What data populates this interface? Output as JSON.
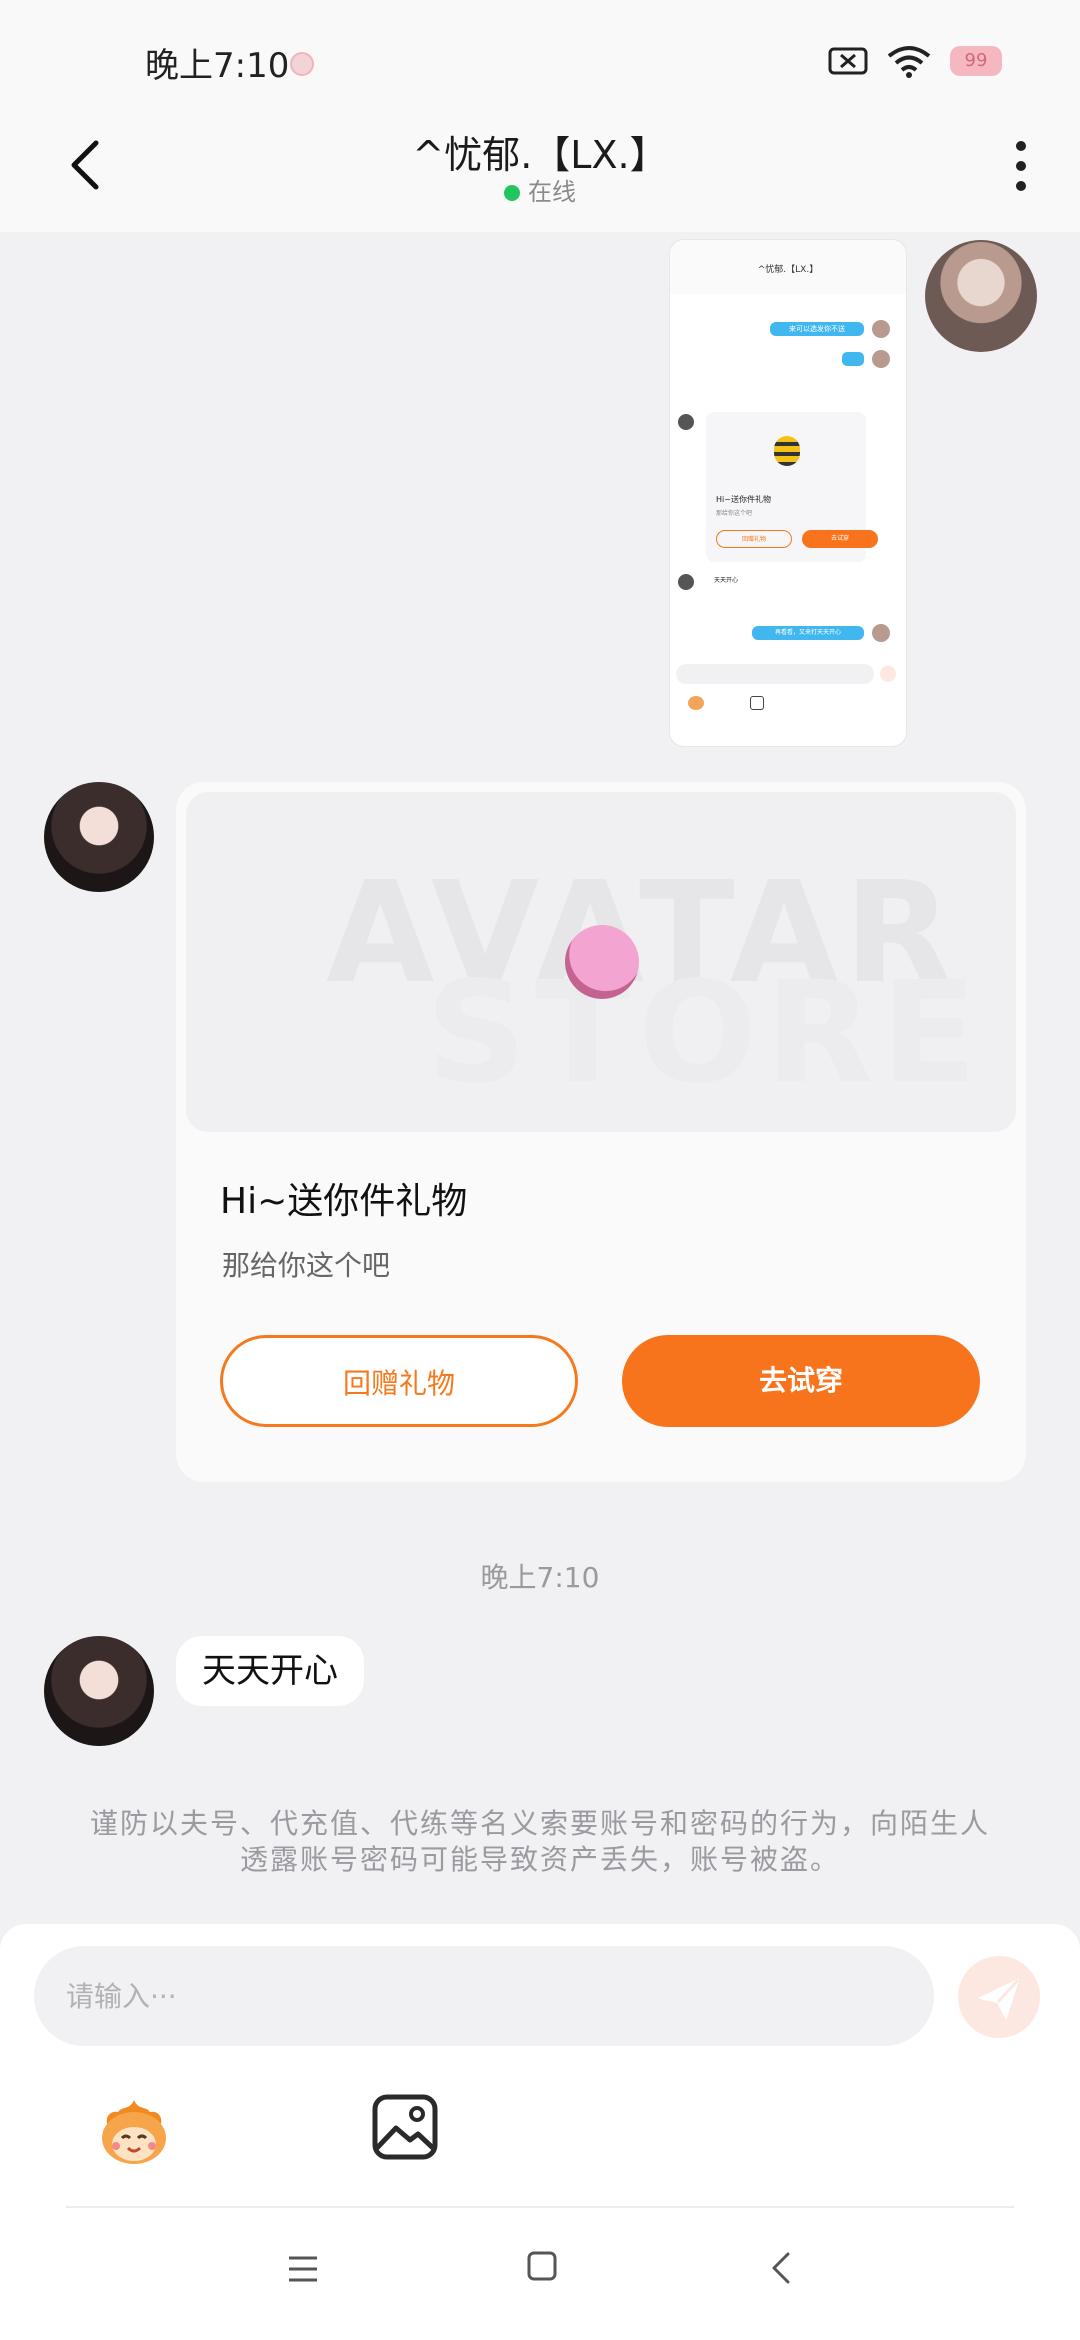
{
  "status_bar": {
    "time": "晚上7:10",
    "battery": "99"
  },
  "header": {
    "title": "^忧郁.【LX.】",
    "status": "在线"
  },
  "screenshot_thumbnail": {
    "title": "^忧郁.【LX.】",
    "bubble_1": "来可以选发你不送",
    "gift_title": "Hi~送你件礼物",
    "gift_sub": "那给你这个吧",
    "btn_return": "回赠礼物",
    "btn_try": "去试穿",
    "text_msg": "天天开心",
    "bubble_2": "再看看，又来打天天开心"
  },
  "gift_card": {
    "watermark_top": "AVATAR",
    "watermark_bottom": "STORE",
    "title": "Hi~送你件礼物",
    "subtitle": "那给你这个吧",
    "return_gift_label": "回赠礼物",
    "try_on_label": "去试穿"
  },
  "timestamp": "晚上7:10",
  "text_message": "天天开心",
  "warning": "谨防以夫号、代充值、代练等名义索要账号和密码的行为，向陌生人透露账号密码可能导致资产丢失，账号被盗。",
  "input": {
    "placeholder": "请输入···"
  },
  "colors": {
    "accent": "#f8741c",
    "online": "#22c55e",
    "background": "#f1f1f4"
  },
  "icons": {
    "back": "back-arrow-icon",
    "more": "more-vertical-icon",
    "send": "send-icon",
    "emoji": "mascot-emoji-icon",
    "image": "image-icon"
  }
}
